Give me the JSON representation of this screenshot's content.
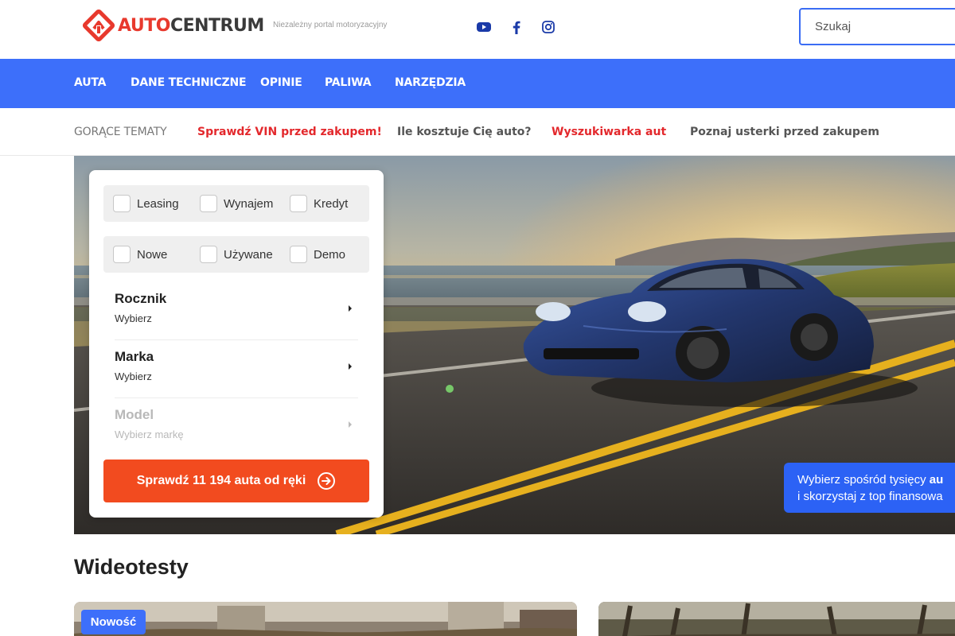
{
  "header": {
    "logo": {
      "part1": "AUTO",
      "part2": "CENTRUM"
    },
    "tagline": "Niezależny portal motoryzacyjny",
    "social": [
      "youtube-icon",
      "facebook-icon",
      "instagram-icon"
    ],
    "search": {
      "placeholder": "Szukaj",
      "value": ""
    }
  },
  "nav": {
    "items": [
      "AUTA",
      "DANE TECHNICZNE",
      "OPINIE",
      "PALIWA",
      "NARZĘDZIA"
    ]
  },
  "hot_topics": {
    "label": "GORĄCE TEMATY",
    "items": [
      {
        "text": "Sprawdź VIN przed zakupem!",
        "style": "red"
      },
      {
        "text": "Ile kosztuje Cię auto?",
        "style": "dark"
      },
      {
        "text": "Wyszukiwarka aut",
        "style": "red"
      },
      {
        "text": "Poznaj usterki przed zakupem",
        "style": "dark"
      }
    ]
  },
  "filter": {
    "row1": [
      "Leasing",
      "Wynajem",
      "Kredyt"
    ],
    "row2": [
      "Nowe",
      "Używane",
      "Demo"
    ],
    "selects": [
      {
        "title": "Rocznik",
        "value": "Wybierz",
        "disabled": false
      },
      {
        "title": "Marka",
        "value": "Wybierz",
        "disabled": false
      },
      {
        "title": "Model",
        "value": "Wybierz markę",
        "disabled": true
      }
    ],
    "cta": "Sprawdź 11 194 auta od ręki"
  },
  "banner": {
    "line1_pre": "Wybierz spośród tysięcy ",
    "line1_bold": "au",
    "line2": "i skorzystaj z top finansowa"
  },
  "videotests": {
    "title": "Wideotesty",
    "badge": "Nowość"
  },
  "colors": {
    "brand_blue": "#3d6ffa",
    "brand_red": "#e8392d",
    "cta_orange": "#f24b1f",
    "topic_red": "#e3282c"
  }
}
